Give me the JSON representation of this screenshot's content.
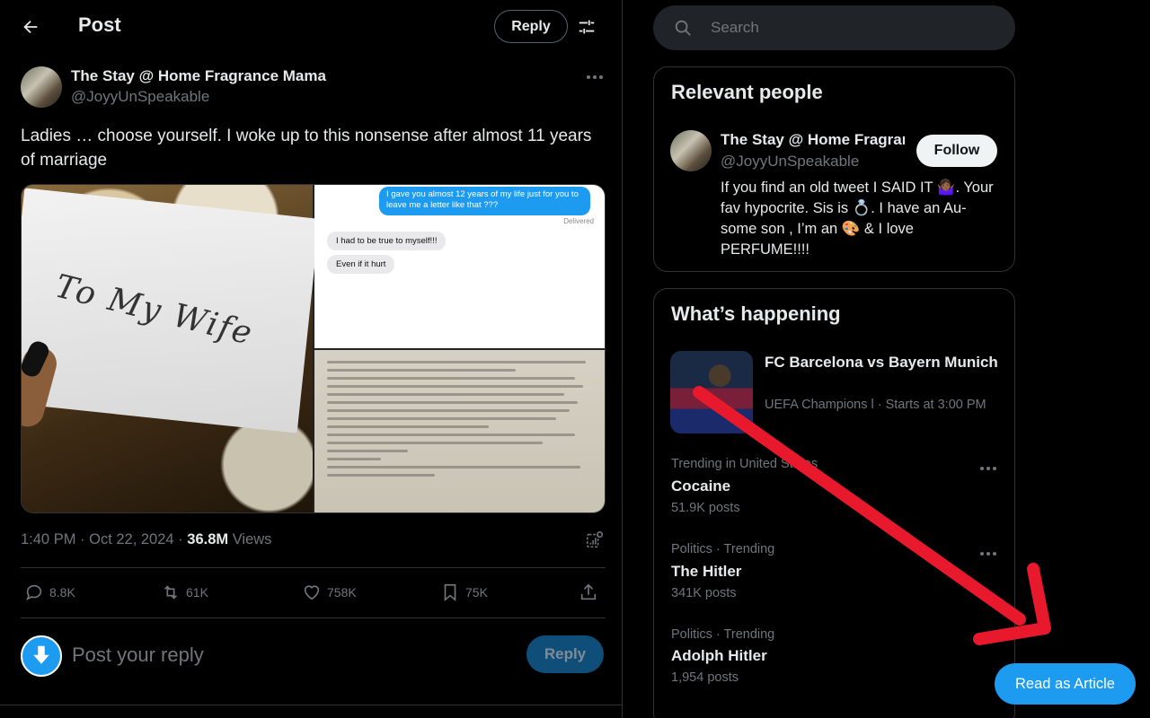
{
  "header": {
    "title": "Post",
    "reply_label": "Reply"
  },
  "tweet": {
    "author_name": "The Stay @ Home Fragrance Mama",
    "author_handle": "@JoyyUnSpeakable",
    "text": "Ladies … choose yourself. I woke up to this nonsense after almost 11 years of marriage",
    "media": {
      "envelope_text": "To My Wife",
      "chat_sent": "I gave you almost 12 years of my life just for you to leave me a letter like that ???",
      "chat_status": "Delivered",
      "chat_received": [
        "I had to be true to myself!!!",
        "Even if it hurt"
      ]
    },
    "time": "1:40 PM · Oct 22, 2024 · ",
    "views_count": "36.8M",
    "views_label": " Views",
    "actions": {
      "replies": "8.8K",
      "reposts": "61K",
      "likes": "758K",
      "bookmarks": "75K"
    }
  },
  "reply_box": {
    "placeholder": "Post your reply",
    "button_label": "Reply"
  },
  "search": {
    "placeholder": "Search"
  },
  "relevant_people": {
    "title": "Relevant people",
    "name": "The Stay @ Home Fragrance Mama",
    "handle": "@JoyyUnSpeakable",
    "follow_label": "Follow",
    "bio": "If you find an old tweet I SAID IT 🤷🏾‍♀️. Your fav hypocrite. Sis is 💍. I have an Au-some son , I’m an 🎨 & I love PERFUME!!!!"
  },
  "whats_happening": {
    "title": "What’s happening",
    "event": {
      "title": "FC Barcelona vs Bayern Munich",
      "subtitle": "UEFA Champions l · Starts at 3:00 PM"
    },
    "trends": [
      {
        "meta": "Trending in United States",
        "name": "Cocaine",
        "count": "51.9K posts"
      },
      {
        "meta": "Politics · Trending",
        "name": "The Hitler",
        "count": "341K posts"
      },
      {
        "meta": "Politics · Trending",
        "name": "Adolph Hitler",
        "count": "1,954 posts"
      }
    ]
  },
  "overlay": {
    "read_as_article": "Read as Article",
    "arrow_color": "#e8192c"
  },
  "colors": {
    "accent": "#1d9bf0",
    "background": "#000000",
    "muted": "#71767b"
  }
}
